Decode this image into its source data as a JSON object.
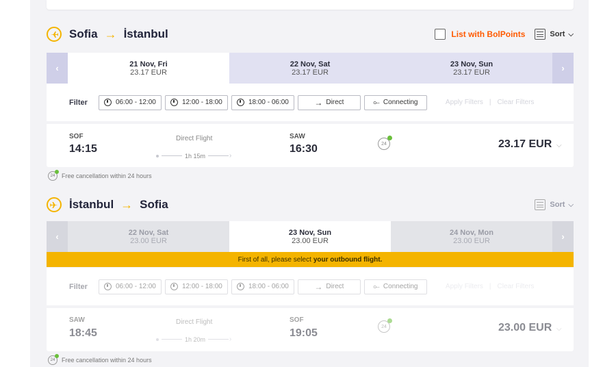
{
  "outbound": {
    "from": "Sofia",
    "to": "İstanbul",
    "bolpoints_label": "List with BolPoints",
    "sort_label": "Sort",
    "dates": [
      {
        "date": "21 Nov, Fri",
        "price": "23.17 EUR",
        "active": true
      },
      {
        "date": "22 Nov, Sat",
        "price": "23.17 EUR",
        "active": false
      },
      {
        "date": "23 Nov, Sun",
        "price": "23.17 EUR",
        "active": false
      }
    ],
    "filter": {
      "label": "Filter",
      "slot1": "06:00 - 12:00",
      "slot2": "12:00 - 18:00",
      "slot3": "18:00 - 06:00",
      "direct": "Direct",
      "connecting": "Connecting",
      "apply": "Apply Filters",
      "clear": "Clear Filters"
    },
    "flight": {
      "dep_code": "SOF",
      "dep_time": "14:15",
      "type": "Direct Flight",
      "duration": "1h 15m",
      "arr_code": "SAW",
      "arr_time": "16:30",
      "badge": "24",
      "price": "23.17 EUR"
    },
    "free_cancel": "Free cancellation within 24 hours"
  },
  "inbound": {
    "from": "İstanbul",
    "to": "Sofia",
    "sort_label": "Sort",
    "dates": [
      {
        "date": "22 Nov, Sat",
        "price": "23.00 EUR",
        "active": false
      },
      {
        "date": "23 Nov, Sun",
        "price": "23.00 EUR",
        "active": true
      },
      {
        "date": "24 Nov, Mon",
        "price": "23.00 EUR",
        "active": false
      }
    ],
    "notice_prefix": "First of all, please select",
    "notice_bold": "your outbound flight.",
    "filter": {
      "label": "Filter",
      "slot1": "06:00 - 12:00",
      "slot2": "12:00 - 18:00",
      "slot3": "18:00 - 06:00",
      "direct": "Direct",
      "connecting": "Connecting",
      "apply": "Apply Filters",
      "clear": "Clear Filters"
    },
    "flight": {
      "dep_code": "SAW",
      "dep_time": "18:45",
      "type": "Direct Flight",
      "duration": "1h 20m",
      "arr_code": "SOF",
      "arr_time": "19:05",
      "badge": "24",
      "price": "23.00 EUR"
    },
    "free_cancel": "Free cancellation within 24 hours"
  },
  "colors": {
    "accent": "#f4b400",
    "bolpoints": "#ff5a00",
    "date_strip": "#e1e1f2",
    "nav": "#cfcfe8"
  },
  "icons": [
    "plane-takeoff-icon",
    "plane-landing-icon",
    "arrow-right-icon",
    "sort-icon",
    "chevron-down-icon",
    "chevron-left-icon",
    "chevron-right-icon",
    "clock-icon",
    "direct-arrow-icon",
    "connecting-icon",
    "cancel-24h-icon"
  ]
}
